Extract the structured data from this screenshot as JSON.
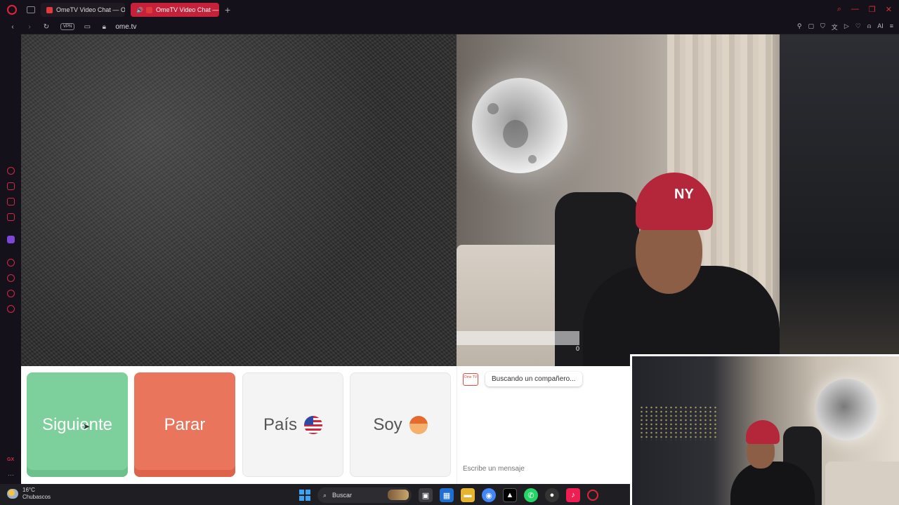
{
  "browser": {
    "tabs": [
      {
        "label": "OmeTV Video Chat — Ome",
        "active": false
      },
      {
        "label": "OmeTV Video Chat — O",
        "active": true
      }
    ],
    "new_tab": "+",
    "vpn_label": "VPN",
    "url": "ome.tv",
    "ai_label": "AI"
  },
  "sidebar": {
    "gx_label": "GX",
    "more": "···"
  },
  "webcam": {
    "reports_count": "0",
    "cap_logo": "NY"
  },
  "controls": {
    "next_label": "Siguiente",
    "stop_label": "Parar",
    "country_label": "País",
    "gender_label": "Soy"
  },
  "chat": {
    "badge": "Ome TV",
    "status_message": "Buscando un compañero...",
    "input_placeholder": "Escribe un mensaje"
  },
  "taskbar": {
    "temperature": "16°C",
    "weather_text": "Chubascos",
    "search_label": "Buscar"
  },
  "colors": {
    "next": "#7dcf9c",
    "stop": "#e9755c",
    "opera_red": "#e0243b"
  }
}
